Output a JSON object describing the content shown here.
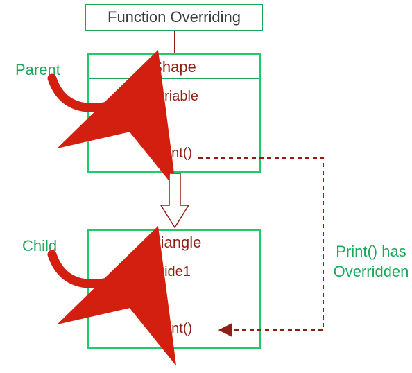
{
  "title": "Function Overriding",
  "parent": {
    "label": "Parent",
    "className": "Shape",
    "variable": "variable",
    "method": "print()"
  },
  "child": {
    "label": "Child",
    "className": "Triangle",
    "variable": "side1",
    "method": "print()"
  },
  "annotation": {
    "overriddenText": "Print() has Overridden"
  }
}
